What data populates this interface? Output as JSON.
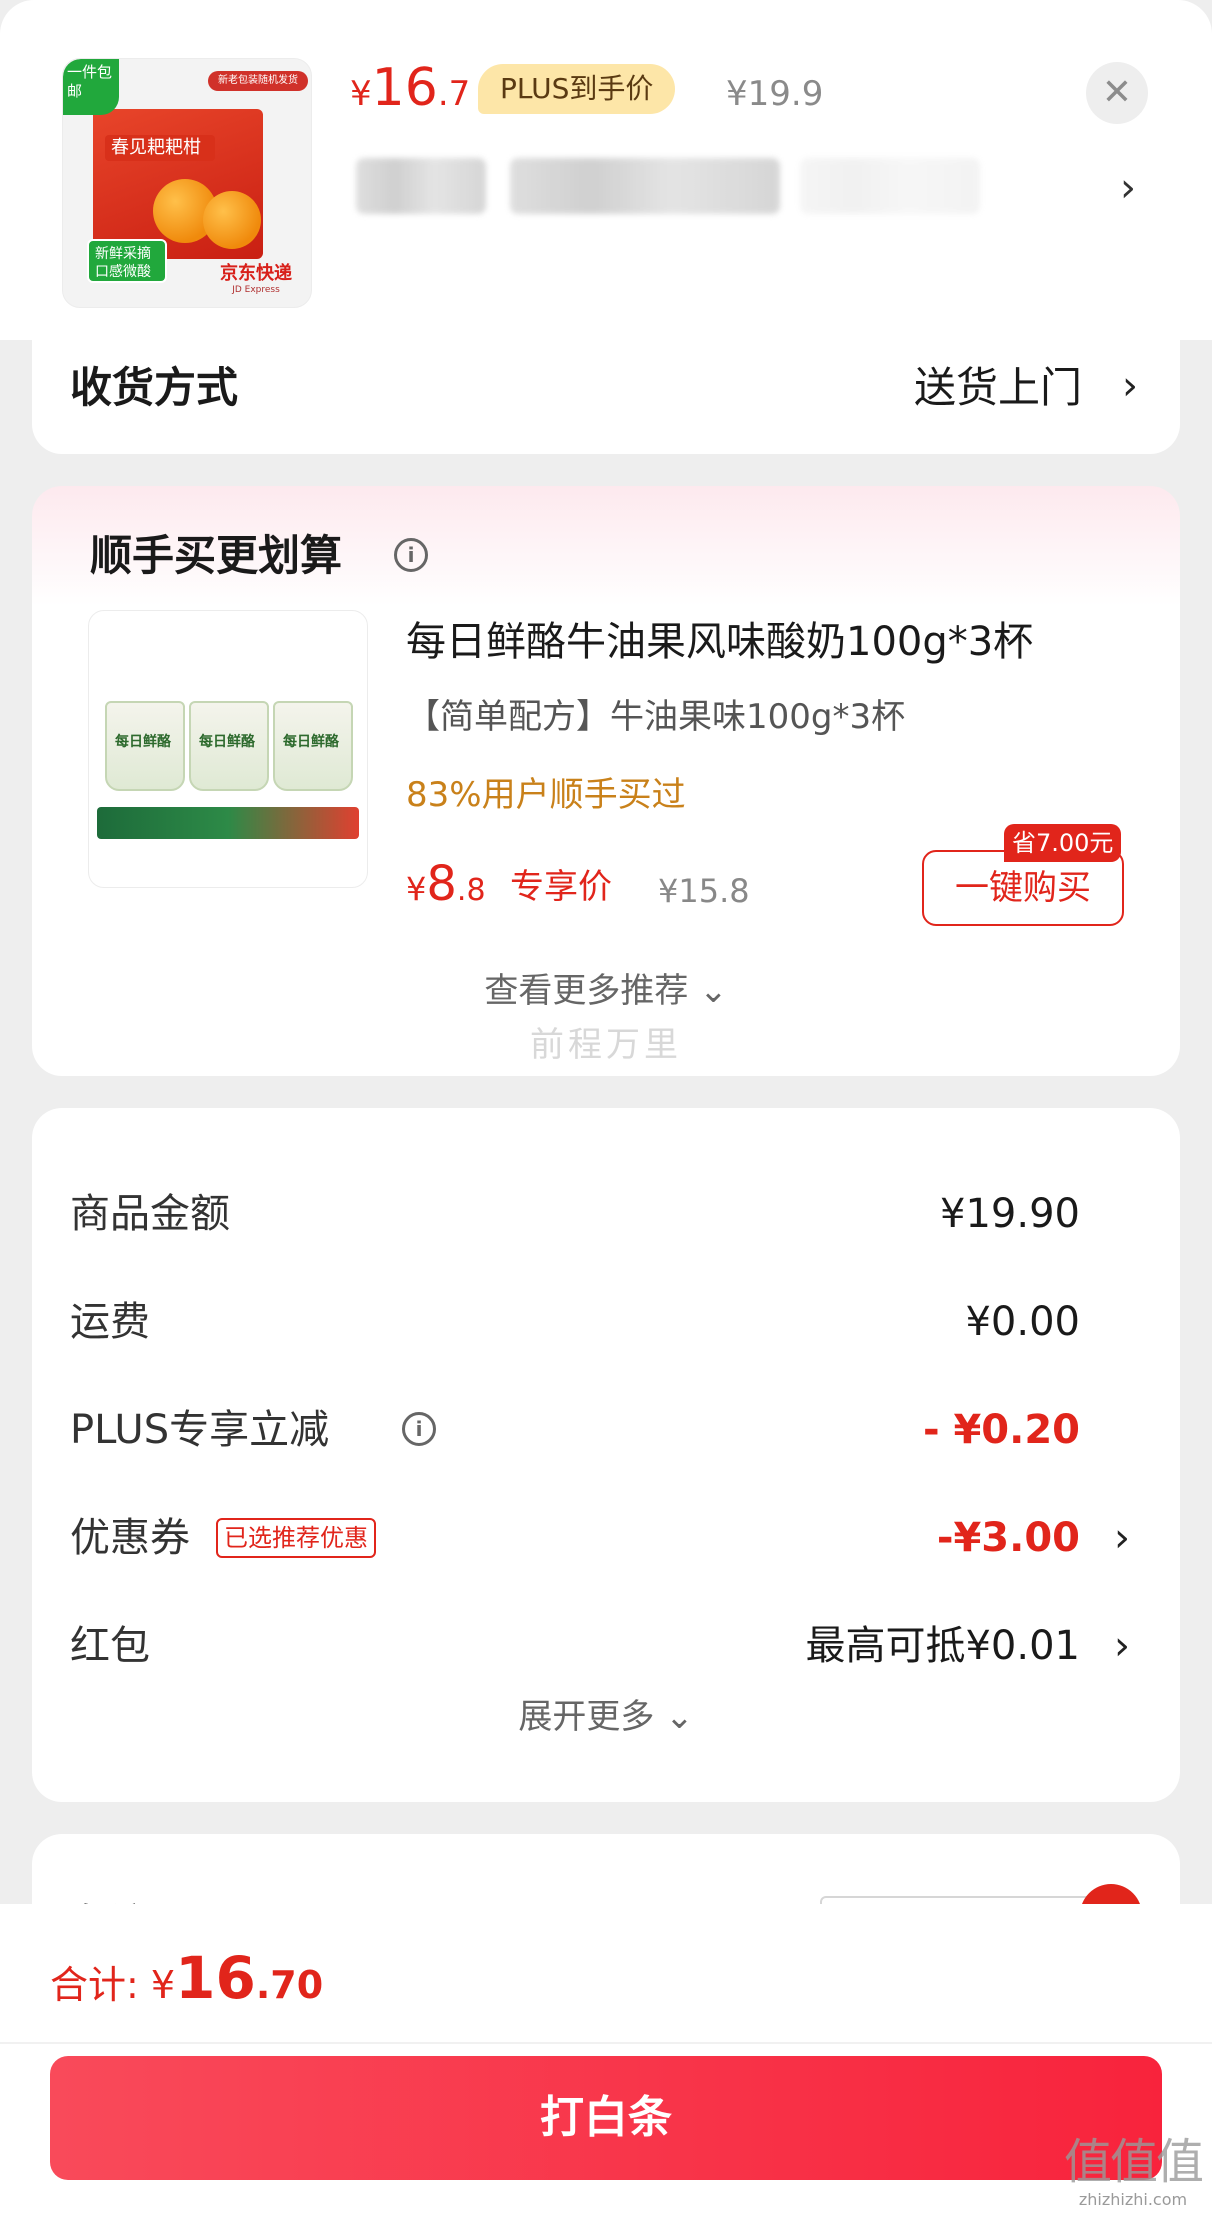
{
  "header": {
    "price_currency": "¥",
    "price_int": "16",
    "price_dec": ".7",
    "plus_label": "PLUS到手价",
    "original_price": "¥19.9",
    "close_icon": "close-icon",
    "chevron": "›",
    "product_image": {
      "corner_label": "一件包邮",
      "box_title": "春见耙耙柑",
      "top_label": "新老包装随机发货",
      "badge": "新鲜采摘口感微酸",
      "express": "京东快递",
      "express_en": "JD Express"
    }
  },
  "delivery": {
    "label": "收货方式",
    "value": "送货上门"
  },
  "recommend": {
    "title": "顺手买更划算",
    "product_name": "每日鲜酪牛油果风味酸奶100g*3杯",
    "spec": "【简单配方】牛油果味100g*3杯",
    "users_bought": "83%用户顺手买过",
    "price_currency": "¥",
    "price_int": "8",
    "price_dec": ".8",
    "exclusive_label": "专享价",
    "original_price": "¥15.8",
    "buy_button": "一键购买",
    "save_tag": "省7.00元",
    "more_label": "查看更多推荐",
    "cup_label": "每日鲜酪",
    "watermark": "前程万里"
  },
  "summary": {
    "rows": [
      {
        "label": "商品金额",
        "value": "¥19.90"
      },
      {
        "label": "运费",
        "value": "¥0.00"
      },
      {
        "label": "PLUS专享立减",
        "value": "- ¥0.20"
      },
      {
        "label": "优惠券",
        "tag": "已选推荐优惠",
        "value": "-¥3.00"
      },
      {
        "label": "红包",
        "value": "最高可抵¥0.01"
      }
    ],
    "expand_label": "展开更多"
  },
  "next_card": {
    "label": "备注"
  },
  "bottom": {
    "total_label": "合计:",
    "total_currency": "¥",
    "total_int": "16",
    "total_dec": ".70",
    "pay_button": "打白条"
  },
  "site_mark": {
    "big": "值值值",
    "small": "zhizhizhi.com"
  },
  "colors": {
    "accent_red": "#e1251b",
    "plus_gold_bg": "#fde6a8",
    "pay_gradient_start": "#f94a5a",
    "pay_gradient_end": "#f8233c",
    "users_bought_orange": "#c9811a"
  }
}
